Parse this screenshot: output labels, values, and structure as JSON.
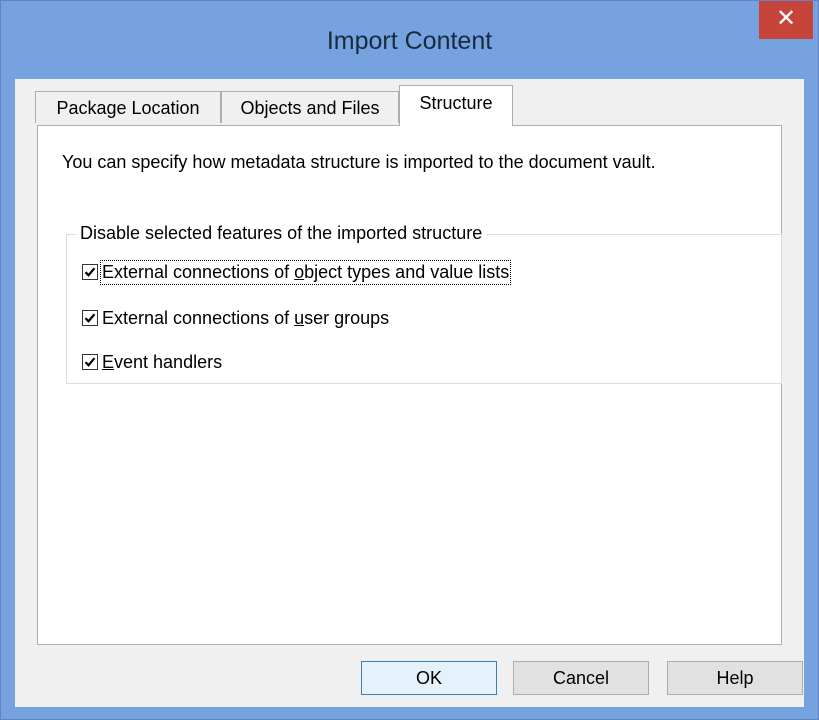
{
  "window": {
    "title": "Import Content",
    "close_label": "✕"
  },
  "tabs": [
    {
      "label": "Package Location",
      "active": false
    },
    {
      "label": "Objects and Files",
      "active": false
    },
    {
      "label": "Structure",
      "active": true
    }
  ],
  "structure": {
    "intro_text": "You can specify how metadata structure is imported to the document vault.",
    "group_label": "Disable selected features of the imported structure",
    "options": [
      {
        "label_before": "External connections of ",
        "mnemonic": "o",
        "label_after": "bject types and value lists",
        "checked": true
      },
      {
        "label_before": "External connections of ",
        "mnemonic": "u",
        "label_after": "ser groups",
        "checked": true
      },
      {
        "label_before": "",
        "mnemonic": "E",
        "label_after": "vent handlers",
        "checked": true
      }
    ]
  },
  "buttons": {
    "ok": "OK",
    "cancel": "Cancel",
    "help": "Help"
  },
  "colors": {
    "title_bar": "#76a3e0",
    "close_button": "#c7443a",
    "dialog_background": "#f0f0f0"
  }
}
